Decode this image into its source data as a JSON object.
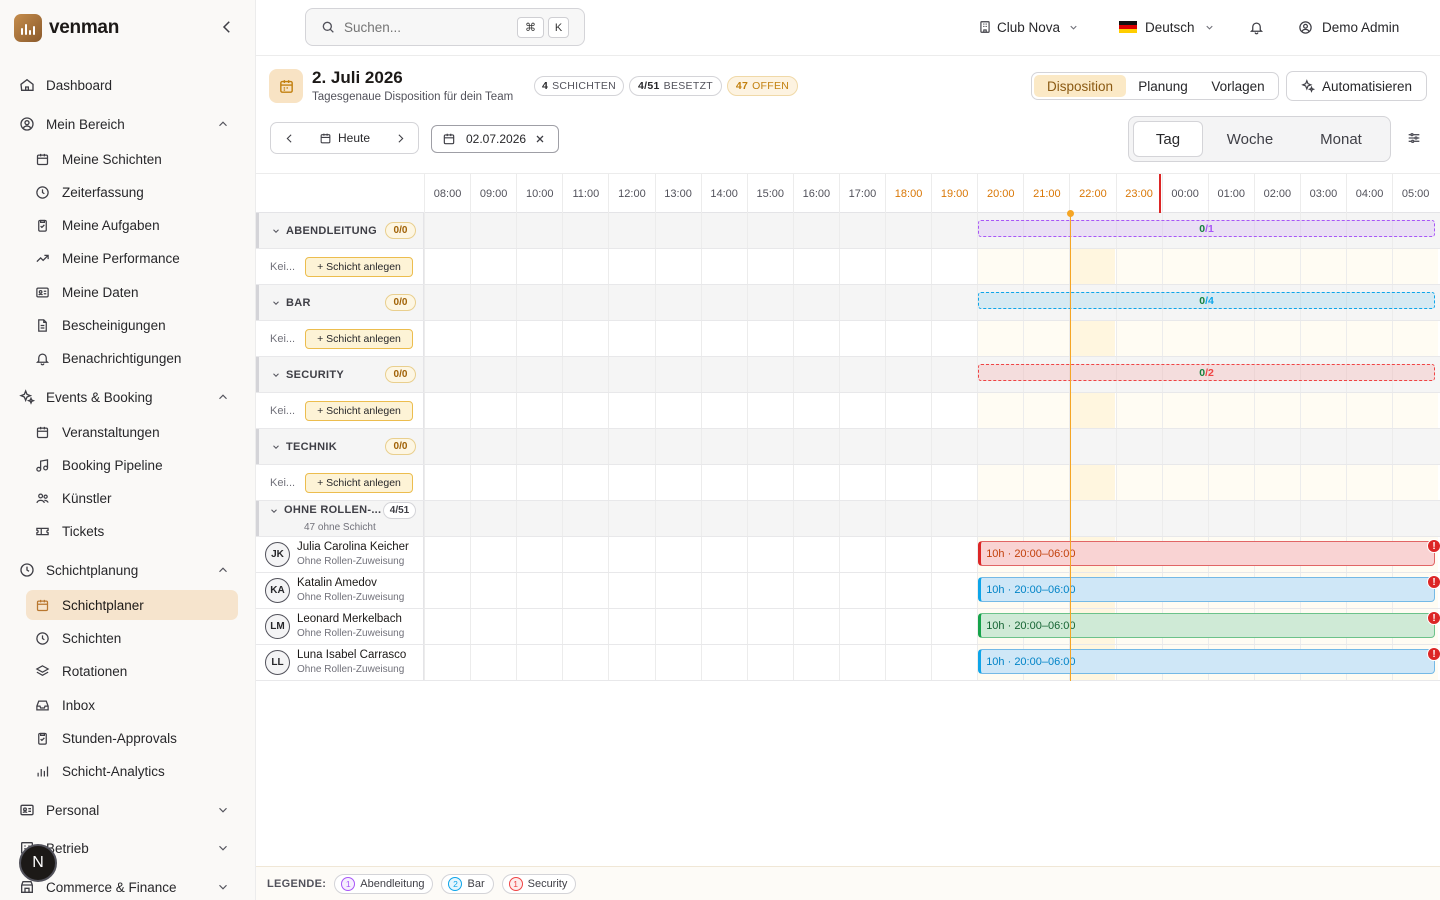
{
  "brand": {
    "name": "venman"
  },
  "nav": {
    "dashboard": "Dashboard",
    "mein_bereich": {
      "label": "Mein Bereich",
      "items": [
        "Meine Schichten",
        "Zeiterfassung",
        "Meine Aufgaben",
        "Meine Performance",
        "Meine Daten",
        "Bescheinigungen",
        "Benachrichtigungen"
      ]
    },
    "events": {
      "label": "Events & Booking",
      "items": [
        "Veranstaltungen",
        "Booking Pipeline",
        "Künstler",
        "Tickets"
      ]
    },
    "schichtplanung": {
      "label": "Schichtplanung",
      "items": [
        "Schichtplaner",
        "Schichten",
        "Rotationen",
        "Inbox",
        "Stunden-Approvals",
        "Schicht-Analytics"
      ]
    },
    "personal": "Personal",
    "betrieb": "Betrieb",
    "commerce": "Commerce & Finance"
  },
  "fab_label": "N",
  "topbar": {
    "search_placeholder": "Suchen...",
    "kbd1": "⌘",
    "kbd2": "K",
    "club": "Club Nova",
    "language": "Deutsch",
    "user": "Demo Admin"
  },
  "header": {
    "title": "2. Juli 2026",
    "subtitle": "Tagesgenaue Disposition für dein Team",
    "pill_shifts_num": "4",
    "pill_shifts_label": "SCHICHTEN",
    "pill_staffed_num": "4/51",
    "pill_staffed_label": "BESETZT",
    "pill_open_num": "47",
    "pill_open_label": "OFFEN",
    "tabs": [
      "Disposition",
      "Planung",
      "Vorlagen"
    ],
    "auto": "Automatisieren",
    "today": "Heute",
    "date": "02.07.2026",
    "views": [
      "Tag",
      "Woche",
      "Monat"
    ]
  },
  "hours": [
    "08:00",
    "09:00",
    "10:00",
    "11:00",
    "12:00",
    "13:00",
    "14:00",
    "15:00",
    "16:00",
    "17:00",
    "18:00",
    "19:00",
    "20:00",
    "21:00",
    "22:00",
    "23:00",
    "00:00",
    "01:00",
    "02:00",
    "03:00",
    "04:00",
    "05:00"
  ],
  "groups": [
    {
      "name": "ABENDLEITUNG",
      "count": "0/0",
      "empty": "Kei...",
      "add": "+ Schicht anlegen",
      "cap_filled": "0",
      "cap_total": "/1",
      "color": "#a855f7"
    },
    {
      "name": "BAR",
      "count": "0/0",
      "empty": "Kei...",
      "add": "+ Schicht anlegen",
      "cap_filled": "0",
      "cap_total": "/4",
      "color": "#0ea5e9"
    },
    {
      "name": "SECURITY",
      "count": "0/0",
      "empty": "Kei...",
      "add": "+ Schicht anlegen",
      "cap_filled": "0",
      "cap_total": "/2",
      "color": "#ef4444"
    },
    {
      "name": "TECHNIK",
      "count": "0/0",
      "empty": "Kei...",
      "add": "+ Schicht anlegen"
    }
  ],
  "unassigned": {
    "name": "OHNE ROLLEN-...",
    "count": "4/51",
    "note": "47 ohne Schicht"
  },
  "people": [
    {
      "initials": "JK",
      "name": "Julia Carolina Keicher",
      "role": "Ohne Rollen-Zuweisung",
      "shift": "10h · 20:00–06:00",
      "kind": "red"
    },
    {
      "initials": "KA",
      "name": "Katalin Amedov",
      "role": "Ohne Rollen-Zuweisung",
      "shift": "10h · 20:00–06:00",
      "kind": "blue"
    },
    {
      "initials": "LM",
      "name": "Leonard Merkelbach",
      "role": "Ohne Rollen-Zuweisung",
      "shift": "10h · 20:00–06:00",
      "kind": "green"
    },
    {
      "initials": "LL",
      "name": "Luna Isabel Carrasco",
      "role": "Ohne Rollen-Zuweisung",
      "shift": "10h · 20:00–06:00",
      "kind": "blue"
    }
  ],
  "warn_symbol": "!",
  "legend": {
    "label": "LEGENDE:",
    "items": [
      {
        "num": "1",
        "label": "Abendleitung",
        "color": "#a855f7"
      },
      {
        "num": "2",
        "label": "Bar",
        "color": "#0ea5e9"
      },
      {
        "num": "1",
        "label": "Security",
        "color": "#ef4444"
      }
    ]
  },
  "colors": {
    "accent": "#f6e4cd",
    "brand": "#b9772f",
    "now": "#f5a524"
  }
}
